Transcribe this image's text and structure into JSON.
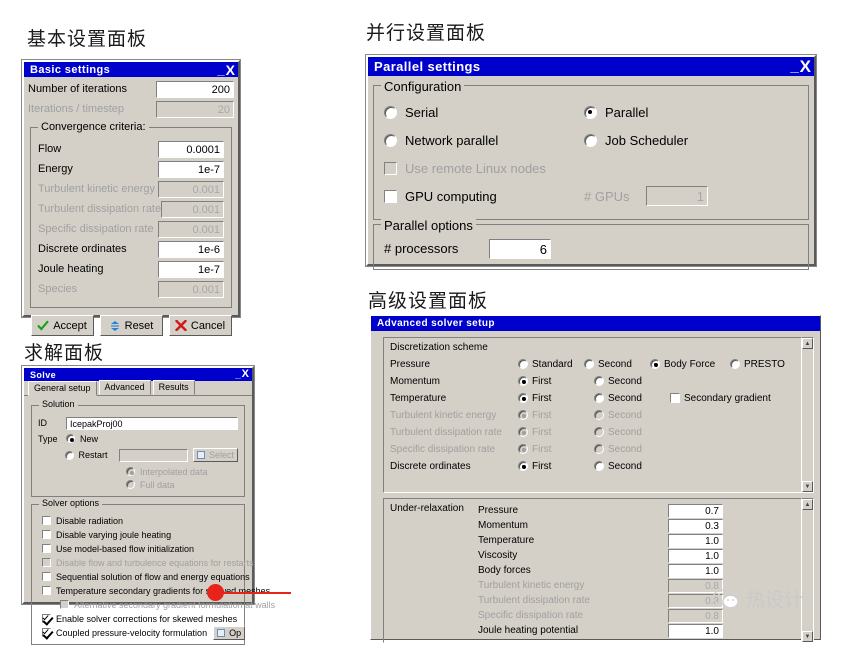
{
  "captions": {
    "basic": "基本设置面板",
    "parallel": "并行设置面板",
    "solve": "求解面板",
    "advanced": "高级设置面板"
  },
  "colors": {
    "titlebar": "#0000cd",
    "dialog_face": "#d4d0c8",
    "disabled_text": "#a0a0a0",
    "annotation": "#e8241a"
  },
  "basic_settings": {
    "title": "Basic settings",
    "minimize_glyph": "_",
    "close_glyph": "X",
    "fields": [
      {
        "label": "Number of iterations",
        "value": "200",
        "enabled": true
      },
      {
        "label": "Iterations / timestep",
        "value": "20",
        "enabled": false
      }
    ],
    "convergence_group": "Convergence criteria:",
    "criteria": [
      {
        "label": "Flow",
        "value": "0.0001",
        "enabled": true
      },
      {
        "label": "Energy",
        "value": "1e-7",
        "enabled": true
      },
      {
        "label": "Turbulent kinetic energy",
        "value": "0.001",
        "enabled": false
      },
      {
        "label": "Turbulent dissipation rate",
        "value": "0.001",
        "enabled": false
      },
      {
        "label": "Specific dissipation rate",
        "value": "0.001",
        "enabled": false
      },
      {
        "label": "Discrete ordinates",
        "value": "1e-6",
        "enabled": true
      },
      {
        "label": "Joule heating",
        "value": "1e-7",
        "enabled": true
      },
      {
        "label": "Species",
        "value": "0.001",
        "enabled": false
      }
    ],
    "buttons": [
      {
        "label": "Accept",
        "icon": "check-icon"
      },
      {
        "label": "Reset",
        "icon": "refresh-icon"
      },
      {
        "label": "Cancel",
        "icon": "cross-icon"
      }
    ]
  },
  "parallel_settings": {
    "title": "Parallel settings",
    "minimize_glyph": "_",
    "close_glyph": "X",
    "configuration_group": "Configuration",
    "radios": [
      {
        "label": "Serial",
        "selected": false,
        "enabled": true
      },
      {
        "label": "Parallel",
        "selected": true,
        "enabled": true
      },
      {
        "label": "Network parallel",
        "selected": false,
        "enabled": true
      },
      {
        "label": "Job Scheduler",
        "selected": false,
        "enabled": true
      }
    ],
    "checkboxes": [
      {
        "label": "Use remote Linux nodes",
        "checked": false,
        "enabled": false
      },
      {
        "label": "GPU computing",
        "checked": false,
        "enabled": true
      }
    ],
    "gpus_label": "# GPUs",
    "gpus_value": "1",
    "gpus_enabled": false,
    "options_group": "Parallel options",
    "processors_label": "# processors",
    "processors_value": "6"
  },
  "solve": {
    "title": "Solve",
    "minimize_glyph": "_",
    "close_glyph": "X",
    "tabs": [
      {
        "label": "General setup",
        "active": true
      },
      {
        "label": "Advanced",
        "active": false
      },
      {
        "label": "Results",
        "active": false
      }
    ],
    "solution_group": "Solution",
    "id_label": "ID",
    "id_value": "IcepakProj00",
    "type_label": "Type",
    "type_new": {
      "label": "New",
      "selected": true,
      "enabled": true
    },
    "type_restart": {
      "label": "Restart",
      "selected": false,
      "enabled": true
    },
    "restart_value": "",
    "select_button": "Select",
    "restart_sub": [
      {
        "label": "Interpolated data",
        "selected": true,
        "enabled": false
      },
      {
        "label": "Full data",
        "selected": false,
        "enabled": false
      }
    ],
    "solver_options_group": "Solver options",
    "solver_options": [
      {
        "label": "Disable radiation",
        "checked": false,
        "enabled": true,
        "indent": false
      },
      {
        "label": "Disable varying joule heating",
        "checked": false,
        "enabled": true,
        "indent": false
      },
      {
        "label": "Use model-based flow initialization",
        "checked": false,
        "enabled": true,
        "indent": false
      },
      {
        "label": "Disable flow and turbulence equations for restarts",
        "checked": false,
        "enabled": false,
        "indent": false
      },
      {
        "label": "Sequential solution of flow and energy equations",
        "checked": false,
        "enabled": true,
        "indent": false
      },
      {
        "label": "Temperature secondary gradients for skewed meshes",
        "checked": false,
        "enabled": true,
        "indent": false
      },
      {
        "label": "Alternative secondary gradient formulation at walls",
        "checked": false,
        "enabled": false,
        "indent": true
      },
      {
        "label": "Enable solver corrections for skewed meshes",
        "checked": true,
        "enabled": true,
        "indent": false
      },
      {
        "label": "Coupled pressure-velocity formulation",
        "checked": true,
        "enabled": true,
        "indent": false
      }
    ],
    "options_button": "Op"
  },
  "advanced_solver": {
    "title": "Advanced solver setup",
    "discretization_label": "Discretization scheme",
    "discretization_rows": [
      {
        "label": "Pressure",
        "enabled": true,
        "options": [
          {
            "label": "Standard",
            "selected": false
          },
          {
            "label": "Second",
            "selected": false
          },
          {
            "label": "Body Force",
            "selected": true
          },
          {
            "label": "PRESTO",
            "selected": false
          }
        ],
        "checkbox": null
      },
      {
        "label": "Momentum",
        "enabled": true,
        "options": [
          {
            "label": "First",
            "selected": true
          },
          {
            "label": "Second",
            "selected": false
          }
        ],
        "checkbox": null
      },
      {
        "label": "Temperature",
        "enabled": true,
        "options": [
          {
            "label": "First",
            "selected": true
          },
          {
            "label": "Second",
            "selected": false
          }
        ],
        "checkbox": {
          "label": "Secondary gradient",
          "checked": false
        }
      },
      {
        "label": "Turbulent kinetic energy",
        "enabled": false,
        "options": [
          {
            "label": "First",
            "selected": true
          },
          {
            "label": "Second",
            "selected": false
          }
        ],
        "checkbox": null
      },
      {
        "label": "Turbulent dissipation rate",
        "enabled": false,
        "options": [
          {
            "label": "First",
            "selected": true
          },
          {
            "label": "Second",
            "selected": false
          }
        ],
        "checkbox": null
      },
      {
        "label": "Specific dissipation rate",
        "enabled": false,
        "options": [
          {
            "label": "First",
            "selected": true
          },
          {
            "label": "Second",
            "selected": false
          }
        ],
        "checkbox": null
      },
      {
        "label": "Discrete ordinates",
        "enabled": true,
        "options": [
          {
            "label": "First",
            "selected": true
          },
          {
            "label": "Second",
            "selected": false
          }
        ],
        "checkbox": null
      }
    ],
    "under_relaxation_label": "Under-relaxation",
    "under_relaxation": [
      {
        "label": "Pressure",
        "value": "0.7",
        "enabled": true
      },
      {
        "label": "Momentum",
        "value": "0.3",
        "enabled": true
      },
      {
        "label": "Temperature",
        "value": "1.0",
        "enabled": true
      },
      {
        "label": "Viscosity",
        "value": "1.0",
        "enabled": true
      },
      {
        "label": "Body forces",
        "value": "1.0",
        "enabled": true
      },
      {
        "label": "Turbulent kinetic energy",
        "value": "0.8",
        "enabled": false
      },
      {
        "label": "Turbulent dissipation rate",
        "value": "0.8",
        "enabled": false
      },
      {
        "label": "Specific dissipation rate",
        "value": "0.8",
        "enabled": false
      },
      {
        "label": "Joule heating potential",
        "value": "1.0",
        "enabled": true
      }
    ]
  },
  "watermark": {
    "text": "热设计",
    "icon": "wechat-icon"
  }
}
